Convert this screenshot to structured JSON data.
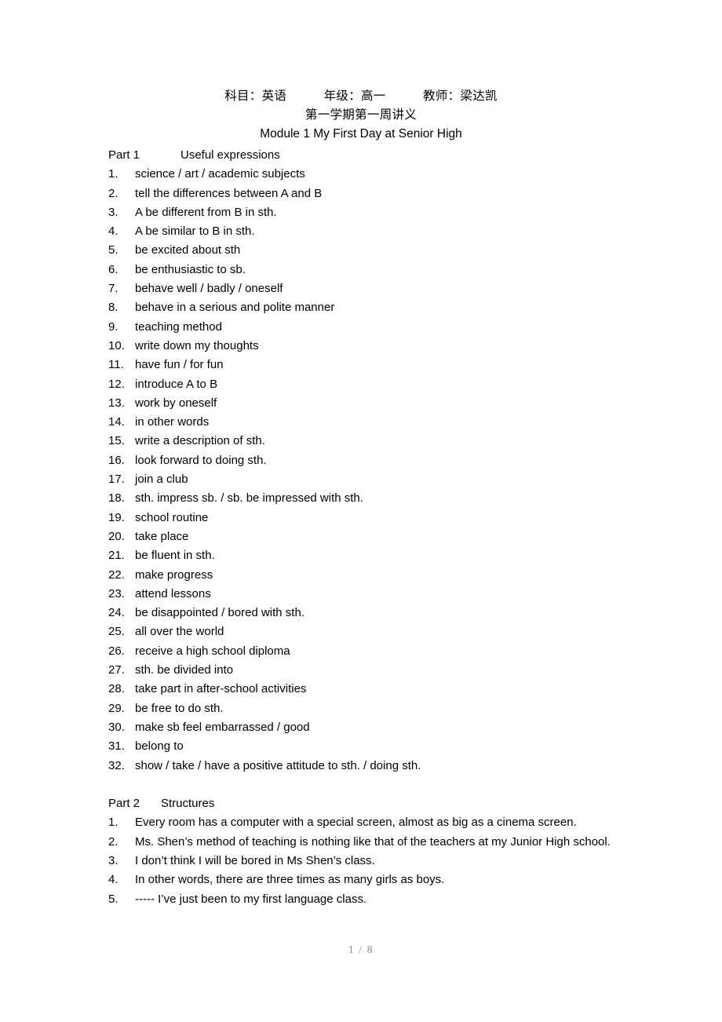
{
  "document": {
    "header": {
      "line1": "科目：英语　　　年级：高一　　　教师：梁达凯",
      "line2": "第一学期第一周讲义",
      "line3": "Module 1 My First Day at Senior High"
    },
    "part1": {
      "label": "Part 1",
      "title": "Useful expressions",
      "items": [
        {
          "num": "1.",
          "text": "science / art / academic subjects"
        },
        {
          "num": "2.",
          "text": "tell the differences between A and B"
        },
        {
          "num": "3.",
          "text": "A be different from B in sth."
        },
        {
          "num": "4.",
          "text": "A be similar to B in sth."
        },
        {
          "num": "5.",
          "text": "be excited about sth"
        },
        {
          "num": "6.",
          "text": "be enthusiastic to sb."
        },
        {
          "num": "7.",
          "text": "behave well / badly / oneself"
        },
        {
          "num": "8.",
          "text": "behave in a serious and polite manner"
        },
        {
          "num": "9.",
          "text": "teaching method"
        },
        {
          "num": "10.",
          "text": "write down my thoughts"
        },
        {
          "num": "11.",
          "text": "have fun / for fun"
        },
        {
          "num": "12.",
          "text": "introduce A to B"
        },
        {
          "num": "13.",
          "text": "work by oneself"
        },
        {
          "num": "14.",
          "text": "in other words"
        },
        {
          "num": "15.",
          "text": "write a description of sth."
        },
        {
          "num": "16.",
          "text": "look forward to doing sth."
        },
        {
          "num": "17.",
          "text": "join a club"
        },
        {
          "num": "18.",
          "text": "sth. impress sb. / sb. be impressed with sth."
        },
        {
          "num": "19.",
          "text": "school routine"
        },
        {
          "num": "20.",
          "text": "take place"
        },
        {
          "num": "21.",
          "text": "be fluent in sth."
        },
        {
          "num": "22.",
          "text": "make progress"
        },
        {
          "num": "23.",
          "text": "attend lessons"
        },
        {
          "num": "24.",
          "text": "be disappointed / bored with sth."
        },
        {
          "num": "25.",
          "text": "all over the world"
        },
        {
          "num": "26.",
          "text": "receive a high school diploma"
        },
        {
          "num": "27.",
          "text": "sth. be divided into"
        },
        {
          "num": "28.",
          "text": "take part in after-school activities"
        },
        {
          "num": "29.",
          "text": "be free to do sth."
        },
        {
          "num": "30.",
          "text": "make sb feel embarrassed / good"
        },
        {
          "num": "31.",
          "text": "belong to"
        },
        {
          "num": "32.",
          "text": "show / take / have a positive attitude to sth. / doing sth."
        }
      ]
    },
    "part2": {
      "label": "Part 2",
      "title": "Structures",
      "items": [
        {
          "num": "1.",
          "text": "Every room has a computer with a special screen, almost as big as a cinema screen."
        },
        {
          "num": "2.",
          "text": "Ms. Shen’s method of teaching is nothing like that of the teachers at my Junior High school."
        },
        {
          "num": "3.",
          "text": "I don’t think I will be bored in Ms Shen’s class."
        },
        {
          "num": "4.",
          "text": "In other words, there are three times as many girls as boys."
        },
        {
          "num": "5.",
          "text": "----- I’ve just been to my first language class."
        }
      ]
    },
    "footer": {
      "page_number": "1 / 8"
    }
  }
}
